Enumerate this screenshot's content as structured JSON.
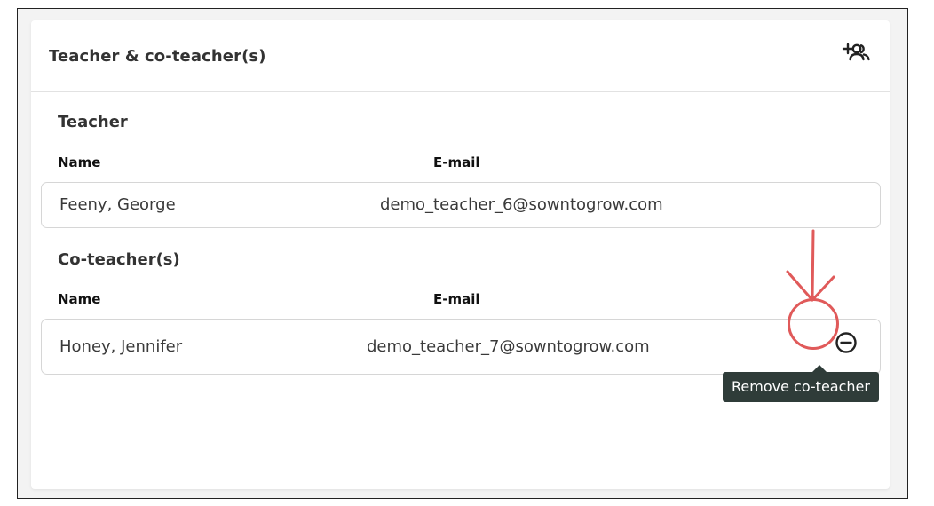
{
  "card": {
    "title": "Teacher & co-teacher(s)",
    "add_icon": "add-person-icon"
  },
  "teacher_section": {
    "title": "Teacher",
    "name_header": "Name",
    "email_header": "E-mail",
    "rows": [
      {
        "name": "Feeny, George",
        "email": "demo_teacher_6@sowntogrow.com"
      }
    ]
  },
  "coteacher_section": {
    "title": "Co-teacher(s)",
    "name_header": "Name",
    "email_header": "E-mail",
    "rows": [
      {
        "name": "Honey, Jennifer",
        "email": "demo_teacher_7@sowntogrow.com",
        "action_icon": "remove-circle-icon"
      }
    ]
  },
  "tooltip": {
    "text": "Remove co-teacher"
  },
  "annotation": {
    "color": "#e05a5a"
  },
  "colors": {
    "tooltip_bg": "#2f3c39",
    "border": "#d6d6d6"
  }
}
